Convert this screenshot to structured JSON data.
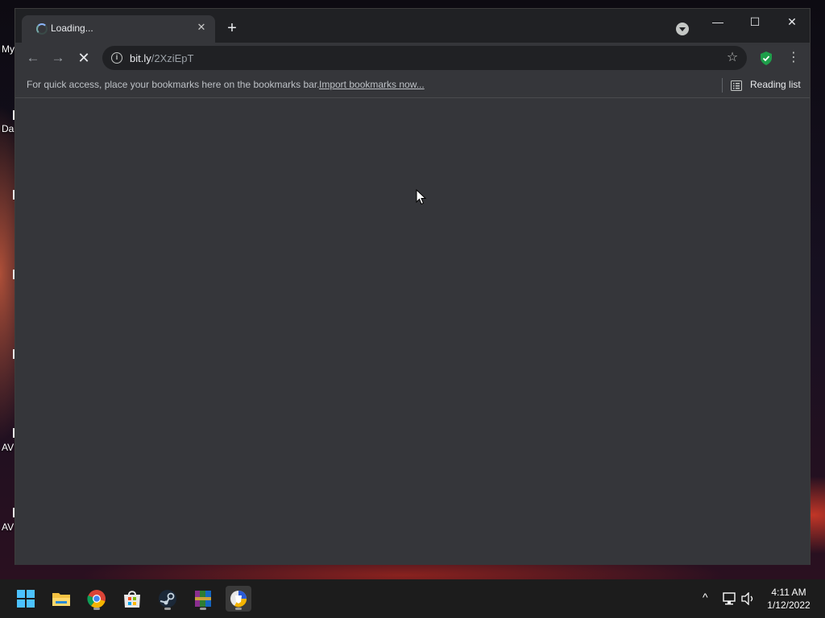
{
  "desktop": {
    "icon_labels": [
      "My",
      "Da",
      "AV",
      "AV"
    ]
  },
  "browser": {
    "tab": {
      "title": "Loading...",
      "close_glyph": "✕"
    },
    "new_tab_glyph": "+",
    "window_controls": {
      "minimize_glyph": "—",
      "maximize_glyph": "☐",
      "close_glyph": "✕"
    },
    "toolbar": {
      "back_glyph": "←",
      "forward_glyph": "→",
      "stop_glyph": "✕",
      "url_host": "bit.ly",
      "url_path": "/2XziEpT",
      "star_glyph": "☆",
      "menu_glyph": "⋮",
      "extension_color": "#1e9e4a"
    },
    "bookmarks_bar": {
      "prompt": "For quick access, place your bookmarks here on the bookmarks bar.",
      "import_link": "Import bookmarks now...",
      "reading_list": "Reading list"
    }
  },
  "taskbar": {
    "apps": [
      "start-icon",
      "file-explorer-icon",
      "chrome-icon",
      "microsoft-store-icon",
      "steam-icon",
      "winrar-icon",
      "avg-browser-icon"
    ],
    "clock": {
      "time": "4:11 AM",
      "date": "1/12/2022"
    },
    "tray": {
      "overflow_glyph": "^"
    }
  }
}
